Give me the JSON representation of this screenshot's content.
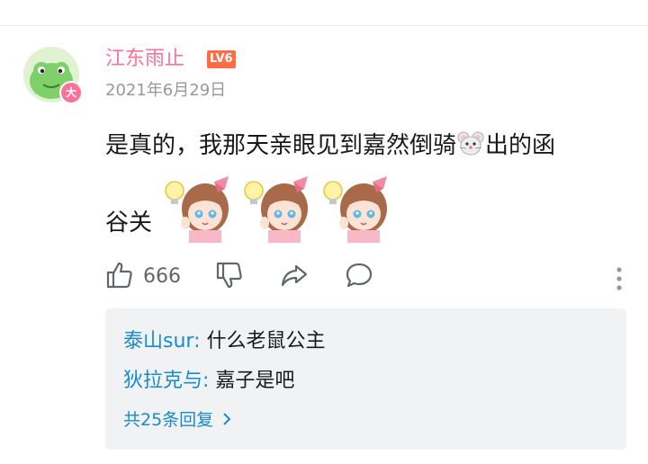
{
  "comment": {
    "username": "江东雨止",
    "level": "LV6",
    "avatar_badge": "大",
    "date": "2021年6月29日",
    "text_part1": "是真的，我那天亲眼见到嘉然倒骑",
    "inline_emoji": "mouse-face-emoji",
    "text_part2": "出的函",
    "text_line2": "谷关",
    "stickers": [
      "idea-girl-sticker",
      "idea-girl-sticker",
      "idea-girl-sticker"
    ]
  },
  "actions": {
    "like_count": "666",
    "icons": [
      "thumbs-up-icon",
      "thumbs-down-icon",
      "share-icon",
      "comment-icon",
      "more-vertical-icon"
    ]
  },
  "replies": {
    "items": [
      {
        "user": "泰山sur",
        "separator": ": ",
        "text": "什么老鼠公主"
      },
      {
        "user": "狄拉克与",
        "separator": ": ",
        "text": "嘉子是吧"
      }
    ],
    "more_label": "共25条回复",
    "more_icon": "chevron-right-icon"
  },
  "colors": {
    "username": "#fb7299",
    "level_badge": "#ff6c46",
    "reply_user": "#178bcf",
    "reply_bg": "#f1f2f3",
    "secondary_text": "#9499a0"
  }
}
